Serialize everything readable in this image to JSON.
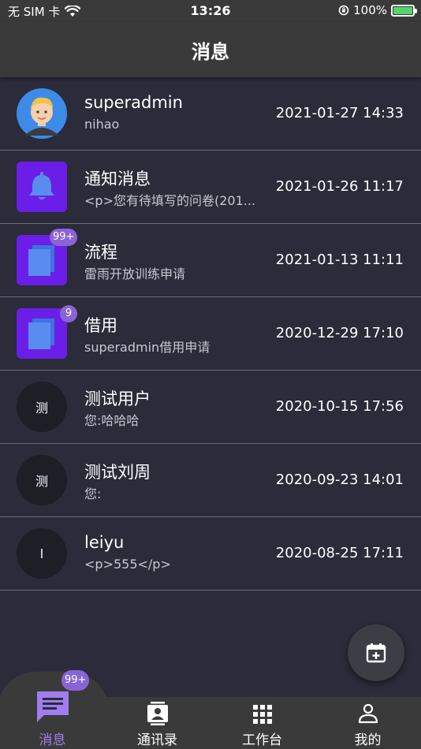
{
  "status_bar": {
    "carrier": "无 SIM 卡",
    "time": "13:26",
    "battery": "100%"
  },
  "header": {
    "title": "消息"
  },
  "messages": [
    {
      "name": "superadmin",
      "preview": "nihao",
      "time": "2021-01-27 14:33",
      "avatar": "user-photo-icon",
      "badge": ""
    },
    {
      "name": "通知消息",
      "preview": "<p>您有待填写的问卷(201...",
      "time": "2021-01-26 11:17",
      "avatar": "bell-icon",
      "badge": ""
    },
    {
      "name": "流程",
      "preview": "雷雨开放训练申请",
      "time": "2021-01-13 11:11",
      "avatar": "documents-icon",
      "badge": "99+"
    },
    {
      "name": "借用",
      "preview": "superadmin借用申请",
      "time": "2020-12-29 17:10",
      "avatar": "documents-icon",
      "badge": "9"
    },
    {
      "name": "测试用户",
      "preview": "您:哈哈哈",
      "time": "2020-10-15 17:56",
      "avatar_text": "测",
      "badge": ""
    },
    {
      "name": "测试刘周",
      "preview": "您:",
      "time": "2020-09-23 14:01",
      "avatar_text": "测",
      "badge": ""
    },
    {
      "name": "leiyu",
      "preview": "<p>555</p>",
      "time": "2020-08-25 17:11",
      "avatar_text": "l",
      "badge": ""
    }
  ],
  "fab": {
    "icon": "calendar-add-icon"
  },
  "tabbar": {
    "badge": "99+",
    "tabs": [
      {
        "label": "消息",
        "icon": "chat-icon",
        "active": true
      },
      {
        "label": "通讯录",
        "icon": "contacts-icon",
        "active": false
      },
      {
        "label": "工作台",
        "icon": "grid-icon",
        "active": false
      },
      {
        "label": "我的",
        "icon": "person-icon",
        "active": false
      }
    ]
  },
  "colors": {
    "background": "#2b2b3a",
    "bar": "#3a3a3a",
    "accent": "#a07df0",
    "badge": "#8a64d6",
    "icon_tile": "#6a1ee8"
  }
}
